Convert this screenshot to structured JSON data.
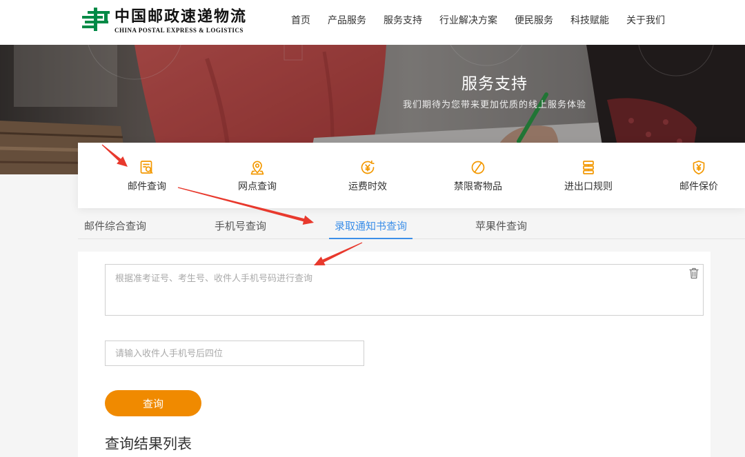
{
  "header": {
    "logo": {
      "icon": "china-post-logo-icon",
      "name_cn": "中国邮政速递物流",
      "name_en": "CHINA POSTAL EXPRESS & LOGISTICS"
    },
    "nav": [
      {
        "label": "首页"
      },
      {
        "label": "产品服务"
      },
      {
        "label": "服务支持"
      },
      {
        "label": "行业解决方案"
      },
      {
        "label": "便民服务"
      },
      {
        "label": "科技赋能"
      },
      {
        "label": "关于我们"
      }
    ]
  },
  "hero": {
    "title": "服务支持",
    "subtitle": "我们期待为您带来更加优质的线上服务体验"
  },
  "services": [
    {
      "label": "邮件查询",
      "icon": "mail-search-icon"
    },
    {
      "label": "网点查询",
      "icon": "location-pin-icon"
    },
    {
      "label": "运费时效",
      "icon": "yen-clock-icon"
    },
    {
      "label": "禁限寄物品",
      "icon": "prohibited-icon"
    },
    {
      "label": "进出口规则",
      "icon": "stack-rules-icon"
    },
    {
      "label": "邮件保价",
      "icon": "yen-shield-icon"
    }
  ],
  "tabs": [
    {
      "label": "邮件综合查询",
      "active": false
    },
    {
      "label": "手机号查询",
      "active": false
    },
    {
      "label": "录取通知书查询",
      "active": true
    },
    {
      "label": "苹果件查询",
      "active": false
    }
  ],
  "form": {
    "query": {
      "placeholder": "根据准考证号、考生号、收件人手机号码进行查询",
      "value": "",
      "clear_icon": "trash-icon"
    },
    "phone": {
      "placeholder": "请输入收件人手机号后四位",
      "value": ""
    },
    "submit_label": "查询"
  },
  "results": {
    "title": "查询结果列表"
  },
  "colors": {
    "brand_green": "#008a46",
    "accent_orange": "#f39800",
    "button_orange": "#f08a00",
    "active_tab_blue": "#3b8ee8",
    "annotation_red": "#e8392d"
  }
}
